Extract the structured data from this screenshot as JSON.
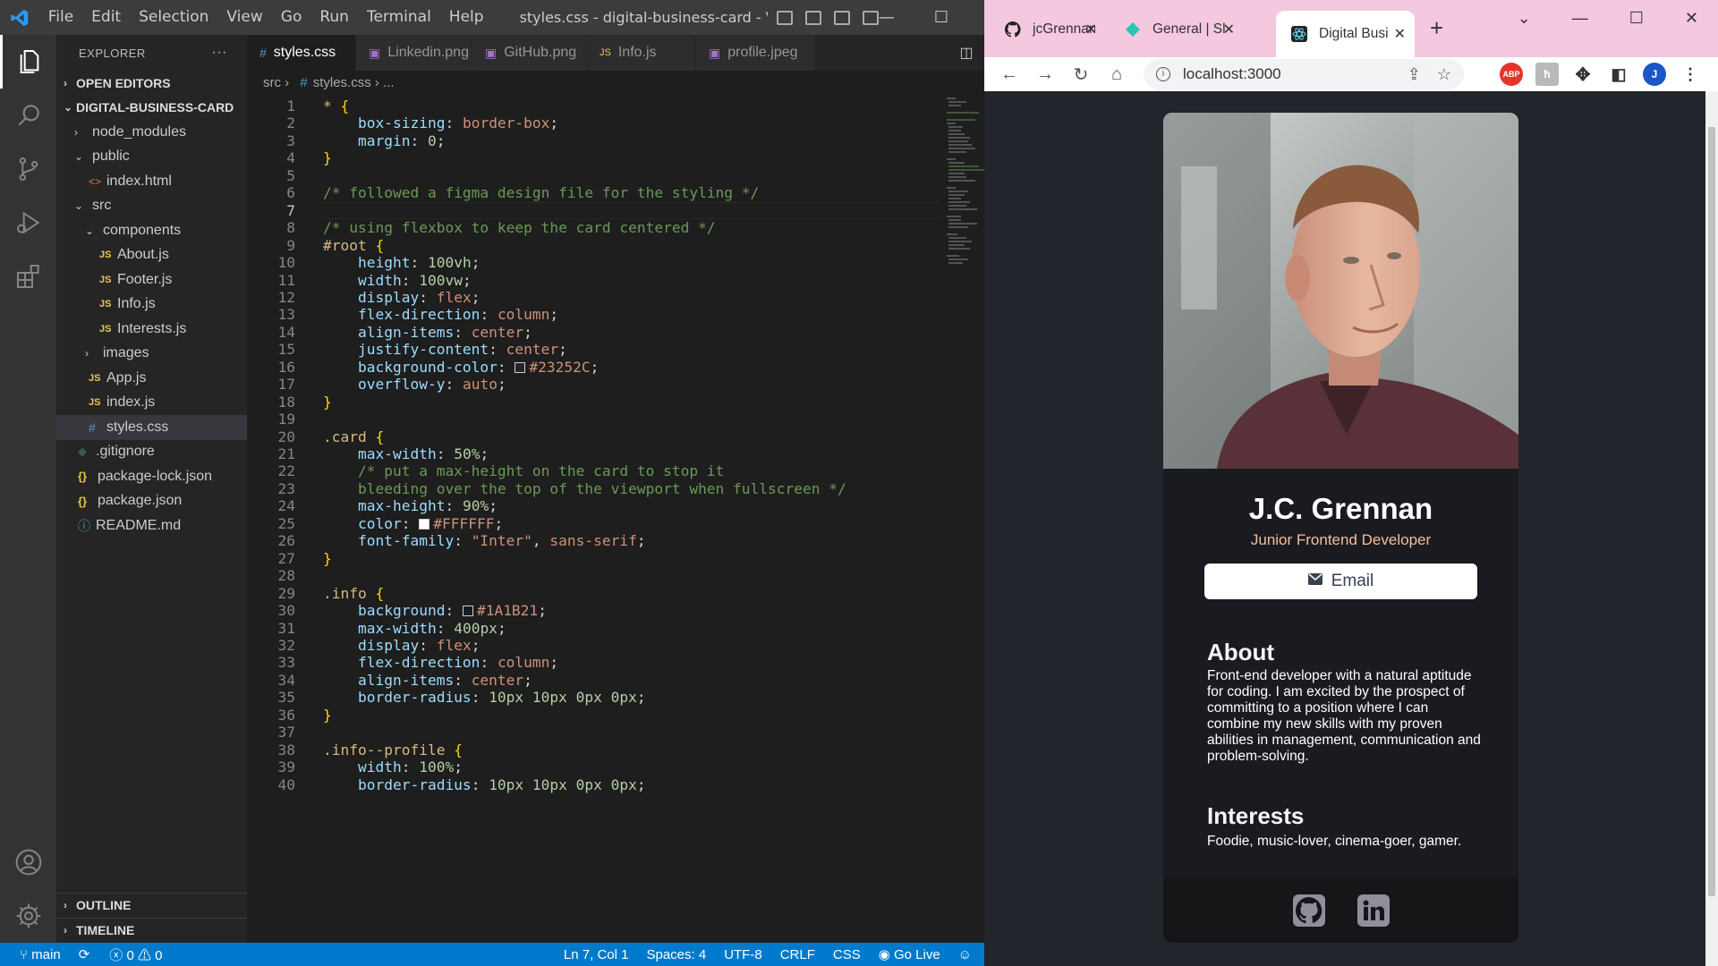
{
  "vscode": {
    "menu": [
      "File",
      "Edit",
      "Selection",
      "View",
      "Go",
      "Run",
      "Terminal",
      "Help"
    ],
    "window_title": "styles.css - digital-business-card - Visual Studio ...",
    "explorer_title": "EXPLORER",
    "sections": {
      "open_editors": "OPEN EDITORS",
      "project": "DIGITAL-BUSINESS-CARD",
      "outline": "OUTLINE",
      "timeline": "TIMELINE"
    },
    "tree": [
      {
        "label": "node_modules",
        "type": "folder",
        "depth": 1,
        "open": false
      },
      {
        "label": "public",
        "type": "folder",
        "depth": 1,
        "open": true
      },
      {
        "label": "index.html",
        "type": "html",
        "depth": 2
      },
      {
        "label": "src",
        "type": "folder",
        "depth": 1,
        "open": true
      },
      {
        "label": "components",
        "type": "folder",
        "depth": 2,
        "open": true
      },
      {
        "label": "About.js",
        "type": "js",
        "depth": 3
      },
      {
        "label": "Footer.js",
        "type": "js",
        "depth": 3
      },
      {
        "label": "Info.js",
        "type": "js",
        "depth": 3
      },
      {
        "label": "Interests.js",
        "type": "js",
        "depth": 3
      },
      {
        "label": "images",
        "type": "folder",
        "depth": 2,
        "open": false
      },
      {
        "label": "App.js",
        "type": "js",
        "depth": 2
      },
      {
        "label": "index.js",
        "type": "js",
        "depth": 2
      },
      {
        "label": "styles.css",
        "type": "css",
        "depth": 2,
        "selected": true
      },
      {
        "label": ".gitignore",
        "type": "git",
        "depth": 1
      },
      {
        "label": "package-lock.json",
        "type": "json",
        "depth": 1
      },
      {
        "label": "package.json",
        "type": "json",
        "depth": 1
      },
      {
        "label": "README.md",
        "type": "info",
        "depth": 1
      }
    ],
    "tabs": [
      {
        "label": "styles.css",
        "icon": "#",
        "active": true
      },
      {
        "label": "Linkedin.png",
        "icon": "▣"
      },
      {
        "label": "GitHub.png",
        "icon": "▣"
      },
      {
        "label": "Info.js",
        "icon": "JS"
      },
      {
        "label": "profile.jpeg",
        "icon": "▣"
      }
    ],
    "breadcrumb": [
      "src",
      "#",
      "styles.css",
      "..."
    ],
    "current_line": 7,
    "code": [
      [
        [
          "sel-c",
          "* "
        ],
        [
          "br",
          "{"
        ]
      ],
      [
        [
          "pn",
          "    "
        ],
        [
          "prop",
          "box-sizing"
        ],
        [
          "pn",
          ": "
        ],
        [
          "val",
          "border-box"
        ],
        [
          "pn",
          ";"
        ]
      ],
      [
        [
          "pn",
          "    "
        ],
        [
          "prop",
          "margin"
        ],
        [
          "pn",
          ": "
        ],
        [
          "num",
          "0"
        ],
        [
          "pn",
          ";"
        ]
      ],
      [
        [
          "br",
          "}"
        ]
      ],
      [],
      [
        [
          "cm",
          "/* followed a figma design file for the styling */"
        ]
      ],
      [],
      [
        [
          "cm",
          "/* using flexbox to keep the card centered */"
        ]
      ],
      [
        [
          "sel-c",
          "#root "
        ],
        [
          "br",
          "{"
        ]
      ],
      [
        [
          "pn",
          "    "
        ],
        [
          "prop",
          "height"
        ],
        [
          "pn",
          ": "
        ],
        [
          "num",
          "100vh"
        ],
        [
          "pn",
          ";"
        ]
      ],
      [
        [
          "pn",
          "    "
        ],
        [
          "prop",
          "width"
        ],
        [
          "pn",
          ": "
        ],
        [
          "num",
          "100vw"
        ],
        [
          "pn",
          ";"
        ]
      ],
      [
        [
          "pn",
          "    "
        ],
        [
          "prop",
          "display"
        ],
        [
          "pn",
          ": "
        ],
        [
          "val",
          "flex"
        ],
        [
          "pn",
          ";"
        ]
      ],
      [
        [
          "pn",
          "    "
        ],
        [
          "prop",
          "flex-direction"
        ],
        [
          "pn",
          ": "
        ],
        [
          "val",
          "column"
        ],
        [
          "pn",
          ";"
        ]
      ],
      [
        [
          "pn",
          "    "
        ],
        [
          "prop",
          "align-items"
        ],
        [
          "pn",
          ": "
        ],
        [
          "val",
          "center"
        ],
        [
          "pn",
          ";"
        ]
      ],
      [
        [
          "pn",
          "    "
        ],
        [
          "prop",
          "justify-content"
        ],
        [
          "pn",
          ": "
        ],
        [
          "val",
          "center"
        ],
        [
          "pn",
          ";"
        ]
      ],
      [
        [
          "pn",
          "    "
        ],
        [
          "prop",
          "background-color"
        ],
        [
          "pn",
          ": "
        ],
        [
          "swatch",
          "#23252C"
        ],
        [
          "val",
          "#23252C"
        ],
        [
          "pn",
          ";"
        ]
      ],
      [
        [
          "pn",
          "    "
        ],
        [
          "prop",
          "overflow-y"
        ],
        [
          "pn",
          ": "
        ],
        [
          "val",
          "auto"
        ],
        [
          "pn",
          ";"
        ]
      ],
      [
        [
          "br",
          "}"
        ]
      ],
      [],
      [
        [
          "sel-c",
          ".card "
        ],
        [
          "br",
          "{"
        ]
      ],
      [
        [
          "pn",
          "    "
        ],
        [
          "prop",
          "max-width"
        ],
        [
          "pn",
          ": "
        ],
        [
          "num",
          "50%"
        ],
        [
          "pn",
          ";"
        ]
      ],
      [
        [
          "cm",
          "    /* put a max-height on the card to stop it"
        ]
      ],
      [
        [
          "cm",
          "    bleeding over the top of the viewport when fullscreen */"
        ]
      ],
      [
        [
          "pn",
          "    "
        ],
        [
          "prop",
          "max-height"
        ],
        [
          "pn",
          ": "
        ],
        [
          "num",
          "90%"
        ],
        [
          "pn",
          ";"
        ]
      ],
      [
        [
          "pn",
          "    "
        ],
        [
          "prop",
          "color"
        ],
        [
          "pn",
          ": "
        ],
        [
          "swatch",
          "#FFFFFF"
        ],
        [
          "val",
          "#FFFFFF"
        ],
        [
          "pn",
          ";"
        ]
      ],
      [
        [
          "pn",
          "    "
        ],
        [
          "prop",
          "font-family"
        ],
        [
          "pn",
          ": "
        ],
        [
          "val",
          "\"Inter\""
        ],
        [
          "pn",
          ", "
        ],
        [
          "val",
          "sans-serif"
        ],
        [
          "pn",
          ";"
        ]
      ],
      [
        [
          "br",
          "}"
        ]
      ],
      [],
      [
        [
          "sel-c",
          ".info "
        ],
        [
          "br",
          "{"
        ]
      ],
      [
        [
          "pn",
          "    "
        ],
        [
          "prop",
          "background"
        ],
        [
          "pn",
          ": "
        ],
        [
          "swatch",
          "#1A1B21"
        ],
        [
          "val",
          "#1A1B21"
        ],
        [
          "pn",
          ";"
        ]
      ],
      [
        [
          "pn",
          "    "
        ],
        [
          "prop",
          "max-width"
        ],
        [
          "pn",
          ": "
        ],
        [
          "num",
          "400px"
        ],
        [
          "pn",
          ";"
        ]
      ],
      [
        [
          "pn",
          "    "
        ],
        [
          "prop",
          "display"
        ],
        [
          "pn",
          ": "
        ],
        [
          "val",
          "flex"
        ],
        [
          "pn",
          ";"
        ]
      ],
      [
        [
          "pn",
          "    "
        ],
        [
          "prop",
          "flex-direction"
        ],
        [
          "pn",
          ": "
        ],
        [
          "val",
          "column"
        ],
        [
          "pn",
          ";"
        ]
      ],
      [
        [
          "pn",
          "    "
        ],
        [
          "prop",
          "align-items"
        ],
        [
          "pn",
          ": "
        ],
        [
          "val",
          "center"
        ],
        [
          "pn",
          ";"
        ]
      ],
      [
        [
          "pn",
          "    "
        ],
        [
          "prop",
          "border-radius"
        ],
        [
          "pn",
          ": "
        ],
        [
          "num",
          "10px 10px 0px 0px"
        ],
        [
          "pn",
          ";"
        ]
      ],
      [
        [
          "br",
          "}"
        ]
      ],
      [],
      [
        [
          "sel-c",
          ".info--profile "
        ],
        [
          "br",
          "{"
        ]
      ],
      [
        [
          "pn",
          "    "
        ],
        [
          "prop",
          "width"
        ],
        [
          "pn",
          ": "
        ],
        [
          "num",
          "100%"
        ],
        [
          "pn",
          ";"
        ]
      ],
      [
        [
          "pn",
          "    "
        ],
        [
          "prop",
          "border-radius"
        ],
        [
          "pn",
          ": "
        ],
        [
          "num",
          "10px 10px 0px 0px"
        ],
        [
          "pn",
          ";"
        ]
      ]
    ],
    "status": {
      "branch": "main",
      "errors": "0",
      "warnings": "0",
      "position": "Ln 7, Col 1",
      "spaces": "Spaces: 4",
      "encoding": "UTF-8",
      "eol": "CRLF",
      "language": "CSS",
      "golive": "Go Live"
    }
  },
  "browser": {
    "tabs": [
      {
        "label": "jcGrennan/d",
        "fav": "github-icon"
      },
      {
        "label": "General | Sl",
        "fav": "scrimba-icon"
      },
      {
        "label": "Digital Busi",
        "fav": "react-icon",
        "active": true
      }
    ],
    "url": "localhost:3000",
    "extensions": [
      "ABP",
      "profile-J"
    ],
    "card": {
      "name": "J.C. Grennan",
      "role": "Junior Frontend Developer",
      "email_label": "Email",
      "about_title": "About",
      "about_text": "Front-end developer with a natural aptitude for coding. I am excited by the prospect of committing to a position where I can combine my new skills with my proven abilities in management, communication and problem-solving.",
      "interests_title": "Interests",
      "interests_text": "Foodie, music-lover, cinema-goer, gamer."
    },
    "colors": {
      "page_bg": "#23252C",
      "card_bg": "#1A1B21",
      "role": "#F3BF99",
      "footer": "#161619",
      "social": "#918E9B"
    }
  }
}
